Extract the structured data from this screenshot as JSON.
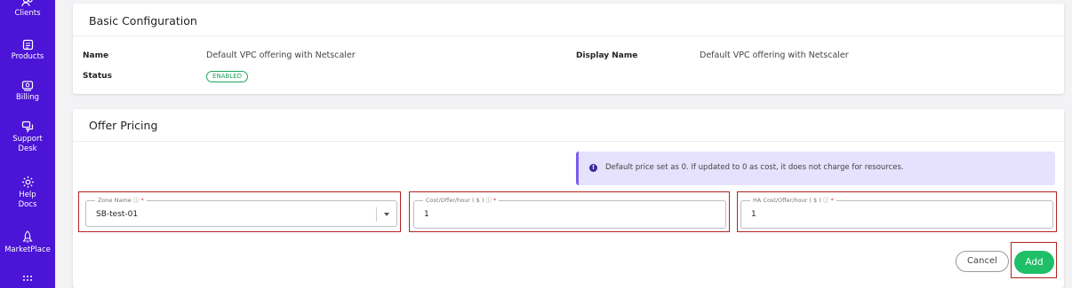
{
  "sidebar": {
    "items": [
      {
        "label": "Clients",
        "icon": "users-icon"
      },
      {
        "label": "Products",
        "icon": "products-icon"
      },
      {
        "label": "Billing",
        "icon": "billing-icon"
      },
      {
        "label": "Support Desk",
        "icon": "chat-icon"
      },
      {
        "label": "Help Docs",
        "icon": "gear-icon"
      },
      {
        "label": "MarketPlace",
        "icon": "rocket-icon"
      },
      {
        "label": "",
        "icon": "grid-icon"
      }
    ]
  },
  "basic": {
    "title": "Basic Configuration",
    "name_label": "Name",
    "name_value": "Default VPC offering with Netscaler",
    "display_name_label": "Display Name",
    "display_name_value": "Default VPC offering with Netscaler",
    "status_label": "Status",
    "status_value": "ENABLED"
  },
  "pricing": {
    "title": "Offer Pricing",
    "info_text": "Default price set as 0. If updated to 0 as cost, it does not charge for resources.",
    "zone_label": "Zone Name",
    "zone_value": "SB-test-01",
    "cost_label": "Cost/Offer/hour ( $ )",
    "cost_value": "1",
    "ha_cost_label": "HA Cost/Offer/hour ( $ )",
    "ha_cost_value": "1",
    "required_mark": "*",
    "cancel_label": "Cancel",
    "add_label": "Add"
  },
  "colors": {
    "sidebar": "#4b14d6",
    "accent_green": "#1fbf68",
    "info_bg": "#e6e1fc",
    "highlight": "#b22222"
  }
}
